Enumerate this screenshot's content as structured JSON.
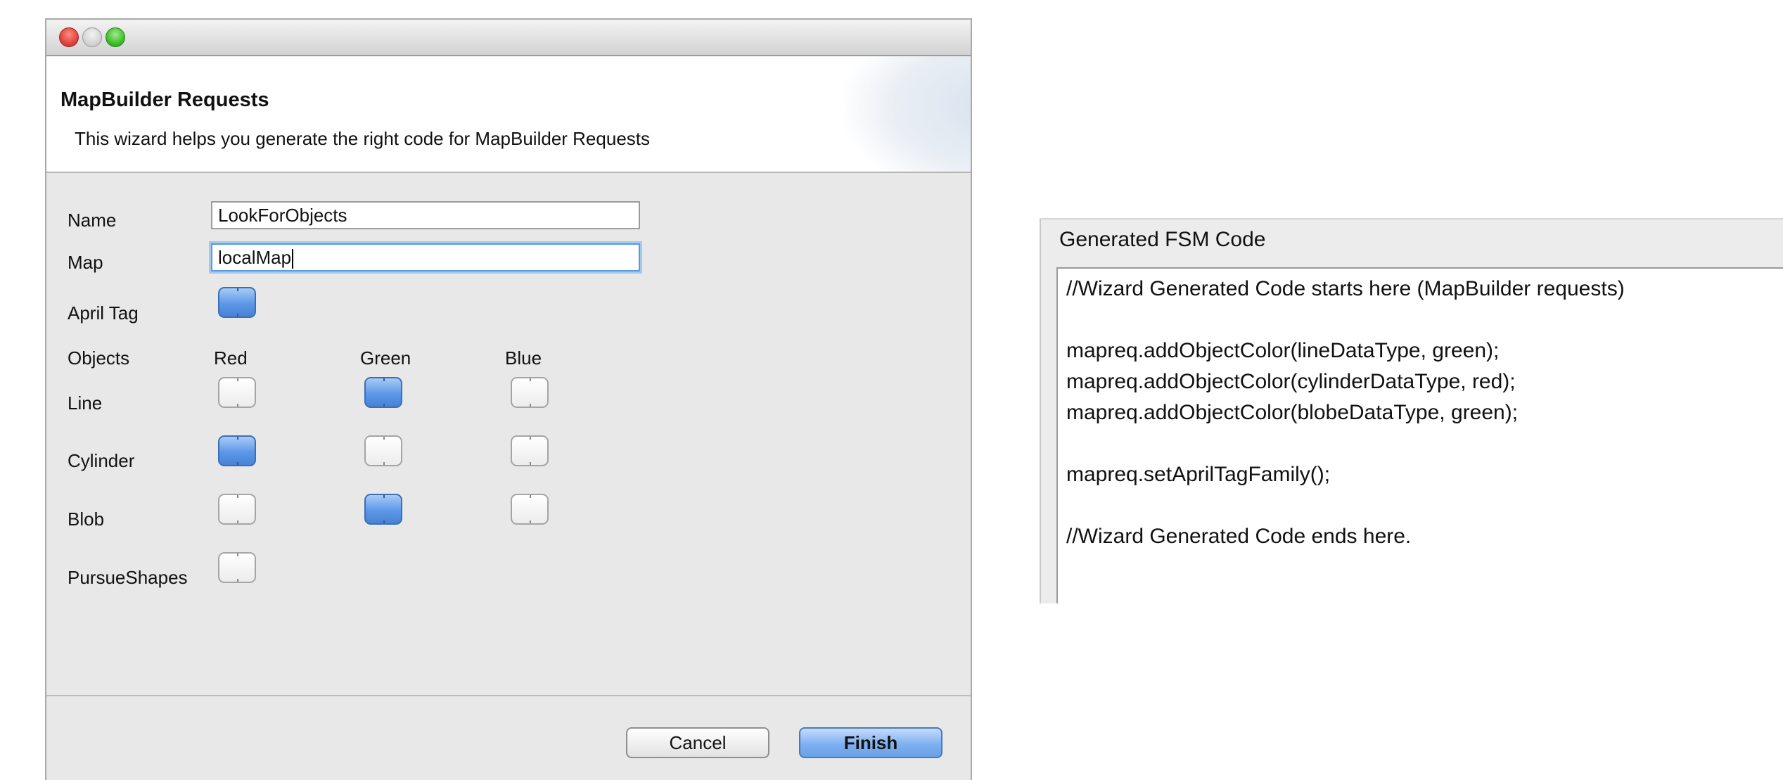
{
  "dialog": {
    "title": "MapBuilder Requests",
    "description": "This wizard helps you generate the right code for MapBuilder Requests",
    "fields": {
      "name_label": "Name",
      "name_value": "LookForObjects",
      "map_label": "Map",
      "map_value": "localMap"
    },
    "april_tag": {
      "label": "April Tag",
      "checked": true
    },
    "objects": {
      "label": "Objects",
      "columns": [
        "Red",
        "Green",
        "Blue"
      ],
      "rows": [
        {
          "label": "Line",
          "checked": [
            false,
            true,
            false
          ]
        },
        {
          "label": "Cylinder",
          "checked": [
            true,
            false,
            false
          ]
        },
        {
          "label": "Blob",
          "checked": [
            false,
            true,
            false
          ]
        }
      ]
    },
    "pursue_shapes": {
      "label": "PursueShapes",
      "checked": false
    },
    "buttons": {
      "cancel": "Cancel",
      "finish": "Finish"
    }
  },
  "code_panel": {
    "title": "Generated FSM Code",
    "lines": [
      "//Wizard Generated Code starts here (MapBuilder requests)",
      "mapreq.addObjectColor(lineDataType, green);",
      "mapreq.addObjectColor(cylinderDataType, red);",
      "mapreq.addObjectColor(blobeDataType, green);",
      "mapreq.setAprilTagFamily();",
      "//Wizard Generated Code ends here."
    ]
  },
  "colors": {
    "checkbox_checked": "#5c97e8",
    "finish_button": "#7fb0f0",
    "focus_ring": "#5b9bd8"
  }
}
